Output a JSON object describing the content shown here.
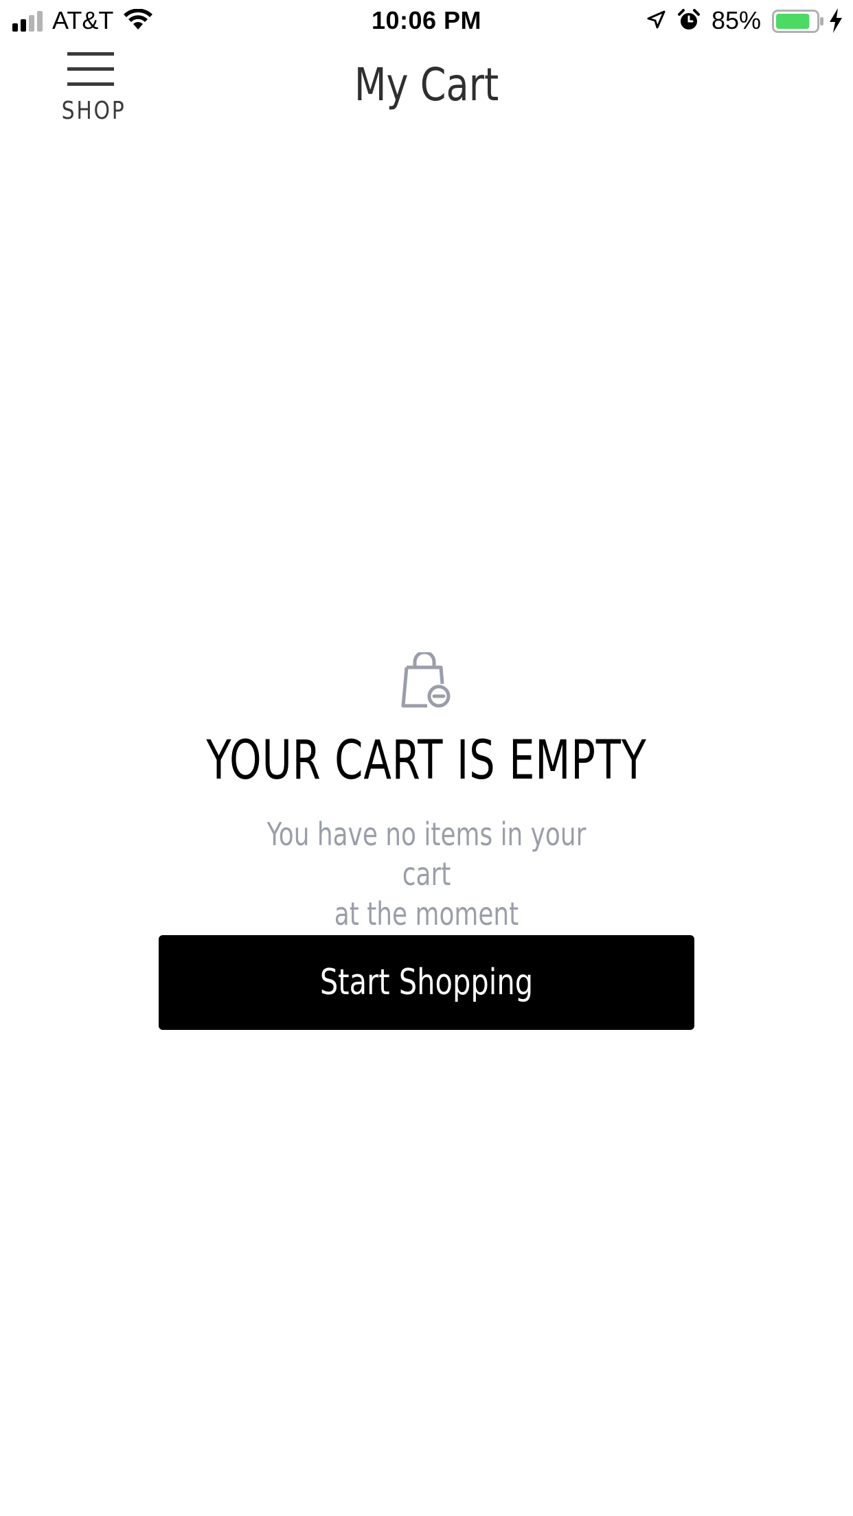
{
  "status_bar": {
    "carrier": "AT&T",
    "time": "10:06 PM",
    "battery_percent": "85%",
    "battery_level": 0.85,
    "battery_color": "#4cd964",
    "icons": [
      "signal-icon",
      "wifi-icon",
      "location-arrow-icon",
      "alarm-clock-icon",
      "battery-icon",
      "charging-bolt-icon"
    ]
  },
  "header": {
    "menu_label": "SHOP",
    "title": "My Cart",
    "menu_icon": "hamburger-menu-icon"
  },
  "empty_state": {
    "icon": "shopping-bag-minus-icon",
    "title": "YOUR CART IS EMPTY",
    "subtitle_line1": "You have no items in your cart",
    "subtitle_line2": "at the moment",
    "button_label": "Start Shopping",
    "colors": {
      "icon": "#9a9eaa",
      "subtitle": "#9a9eaa",
      "button_bg": "#000000",
      "button_text": "#ffffff"
    }
  }
}
